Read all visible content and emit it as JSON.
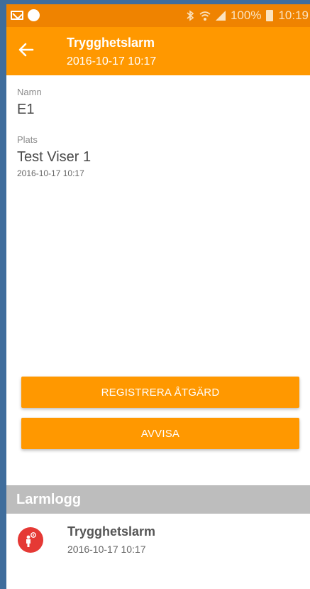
{
  "status_bar": {
    "battery": "100%",
    "time": "10:19"
  },
  "app_bar": {
    "title": "Trygghetslarm",
    "subtitle": "2016-10-17 10:17"
  },
  "details": {
    "name_label": "Namn",
    "name_value": "E1",
    "place_label": "Plats",
    "place_value": "Test Viser 1",
    "place_time": "2016-10-17 10:17"
  },
  "actions": {
    "register_label": "REGISTRERA ÅTGÄRD",
    "reject_label": "AVVISA"
  },
  "alarm_log": {
    "header": "Larmlogg",
    "items": [
      {
        "title": "Trygghetslarm",
        "time": "2016-10-17 10:17"
      }
    ]
  },
  "colors": {
    "accent": "#ff9800",
    "status_bar": "#ef8300",
    "alarm_icon_bg": "#e53935"
  }
}
